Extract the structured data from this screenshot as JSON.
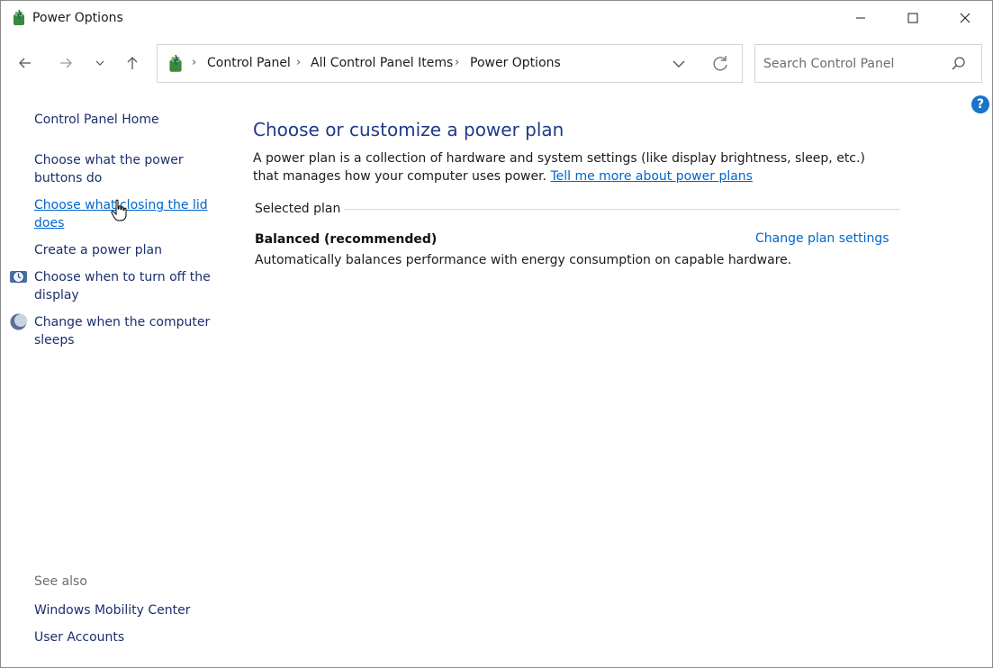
{
  "window": {
    "title": "Power Options"
  },
  "address_bar": {
    "breadcrumbs": [
      "Control Panel",
      "All Control Panel Items",
      "Power Options"
    ]
  },
  "search": {
    "placeholder": "Search Control Panel"
  },
  "left_pane": {
    "home": "Control Panel Home",
    "links": [
      {
        "label_line1": "Choose what the power",
        "label_line2": "buttons do",
        "icon": null
      },
      {
        "label_line1": "Choose what closing the lid",
        "label_line2": "does",
        "icon": null,
        "hovered": true
      },
      {
        "label_line1": "Create a power plan",
        "label_line2": "",
        "icon": null
      },
      {
        "label_line1": "Choose when to turn off the",
        "label_line2": "display",
        "icon": "display-clock-icon"
      },
      {
        "label_line1": "Change when the computer",
        "label_line2": "sleeps",
        "icon": "moon-sleep-icon"
      }
    ],
    "see_also_title": "See also",
    "see_also": [
      "Windows Mobility Center",
      "User Accounts"
    ]
  },
  "main": {
    "heading": "Choose or customize a power plan",
    "description": "A power plan is a collection of hardware and system settings (like display brightness, sleep, etc.) that manages how your computer uses power.",
    "description_link": "Tell me more about power plans",
    "selected_plan_label": "Selected plan",
    "plan": {
      "name": "Balanced (recommended)",
      "change_link": "Change plan settings",
      "description": "Automatically balances performance with energy consumption on capable hardware."
    }
  },
  "colors": {
    "link": "#0066cc",
    "heading": "#1e3a8a",
    "help_badge": "#1a73c9"
  }
}
